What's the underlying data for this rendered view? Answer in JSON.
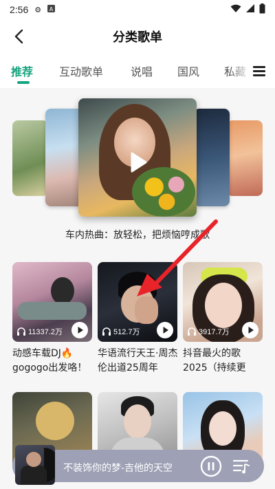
{
  "status_bar": {
    "time": "2:56",
    "icons": [
      "settings-icon",
      "a-icon",
      "wifi-icon",
      "signal-icon",
      "battery-icon"
    ]
  },
  "header": {
    "title": "分类歌单",
    "back_icon": "chevron-left-icon"
  },
  "tabs": [
    {
      "label": "推荐",
      "active": true
    },
    {
      "label": "互动歌单",
      "active": false
    },
    {
      "label": "说唱",
      "active": false
    },
    {
      "label": "国风",
      "active": false
    },
    {
      "label": "私藏",
      "active": false
    }
  ],
  "carousel": {
    "caption": "车内热曲：放轻松，把烦恼哼成歌"
  },
  "playlists": [
    {
      "play_count": "11337.2万",
      "title": "动感车载DJ🔥gogogo出发咯！"
    },
    {
      "play_count": "512.7万",
      "title": "华语流行天王·周杰伦出道25周年"
    },
    {
      "play_count": "3917.7万",
      "title": "抖音最火的歌2025（持续更"
    },
    {
      "play_count": "",
      "title": ""
    },
    {
      "play_count": "",
      "title": ""
    },
    {
      "play_count": "",
      "title": ""
    }
  ],
  "player": {
    "song": "不装饰你的梦-吉他的天空"
  },
  "colors": {
    "accent": "#16a37e",
    "player_bg": "#9ea0b5",
    "arrow": "#e8232a"
  }
}
